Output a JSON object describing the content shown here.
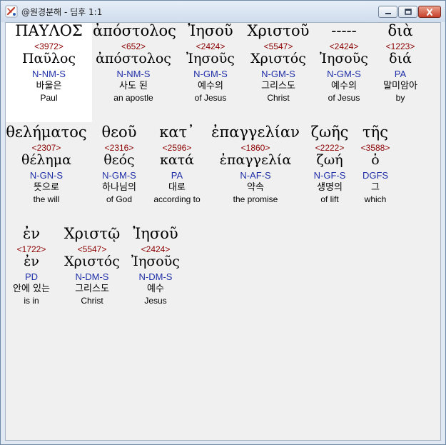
{
  "window": {
    "title": "@원경분해 - 딤후 1:1"
  },
  "lines": [
    {
      "words": [
        {
          "greek": "ΠΑΥΛΟΣ",
          "strong": "<3972>",
          "lemma": "Παῦλος",
          "parse": "N-NM-S",
          "korean": "바울은",
          "english": "Paul"
        },
        {
          "greek": "ἀπόστολος",
          "strong": "<652>",
          "lemma": "ἀπόστολος",
          "parse": "N-NM-S",
          "korean": "사도 된",
          "english": "an apostle"
        },
        {
          "greek": "Ἰησοῦ",
          "strong": "<2424>",
          "lemma": "Ἰησοῦς",
          "parse": "N-GM-S",
          "korean": "예수의",
          "english": "of Jesus"
        },
        {
          "greek": "Χριστοῦ",
          "strong": "<5547>",
          "lemma": "Χριστός",
          "parse": "N-GM-S",
          "korean": "그리스도",
          "english": "Christ"
        },
        {
          "greek": "-----",
          "strong": "<2424>",
          "lemma": "Ἰησοῦς",
          "parse": "N-GM-S",
          "korean": "예수의",
          "english": "of Jesus"
        },
        {
          "greek": "διὰ",
          "strong": "<1223>",
          "lemma": "διά",
          "parse": "PA",
          "korean": "말미암아",
          "english": "by"
        }
      ]
    },
    {
      "words": [
        {
          "greek": "θελήματος",
          "strong": "<2307>",
          "lemma": "θέλημα",
          "parse": "N-GN-S",
          "korean": "뜻으로",
          "english": "the will"
        },
        {
          "greek": "θεοῦ",
          "strong": "<2316>",
          "lemma": "θεός",
          "parse": "N-GM-S",
          "korean": "하나님의",
          "english": "of God"
        },
        {
          "greek": "κατ᾽",
          "strong": "<2596>",
          "lemma": "κατά",
          "parse": "PA",
          "korean": "대로",
          "english": "according to"
        },
        {
          "greek": "ἐπαγγελίαν",
          "strong": "<1860>",
          "lemma": "ἐπαγγελία",
          "parse": "N-AF-S",
          "korean": "약속",
          "english": "the promise"
        },
        {
          "greek": "ζωῆς",
          "strong": "<2222>",
          "lemma": "ζωή",
          "parse": "N-GF-S",
          "korean": "생명의",
          "english": "of lift"
        },
        {
          "greek": "τῆς",
          "strong": "<3588>",
          "lemma": "ὁ",
          "parse": "DGFS",
          "korean": "그",
          "english": "which"
        }
      ]
    },
    {
      "words": [
        {
          "greek": "ἐν",
          "strong": "<1722>",
          "lemma": "ἐν",
          "parse": "PD",
          "korean": "안에 있는",
          "english": "is in"
        },
        {
          "greek": "Χριστῷ",
          "strong": "<5547>",
          "lemma": "Χριστός",
          "parse": "N-DM-S",
          "korean": "그리스도",
          "english": "Christ"
        },
        {
          "greek": "Ἰησοῦ",
          "strong": "<2424>",
          "lemma": "Ἰησοῦς",
          "parse": "N-DM-S",
          "korean": "예수",
          "english": "Jesus"
        }
      ]
    }
  ]
}
